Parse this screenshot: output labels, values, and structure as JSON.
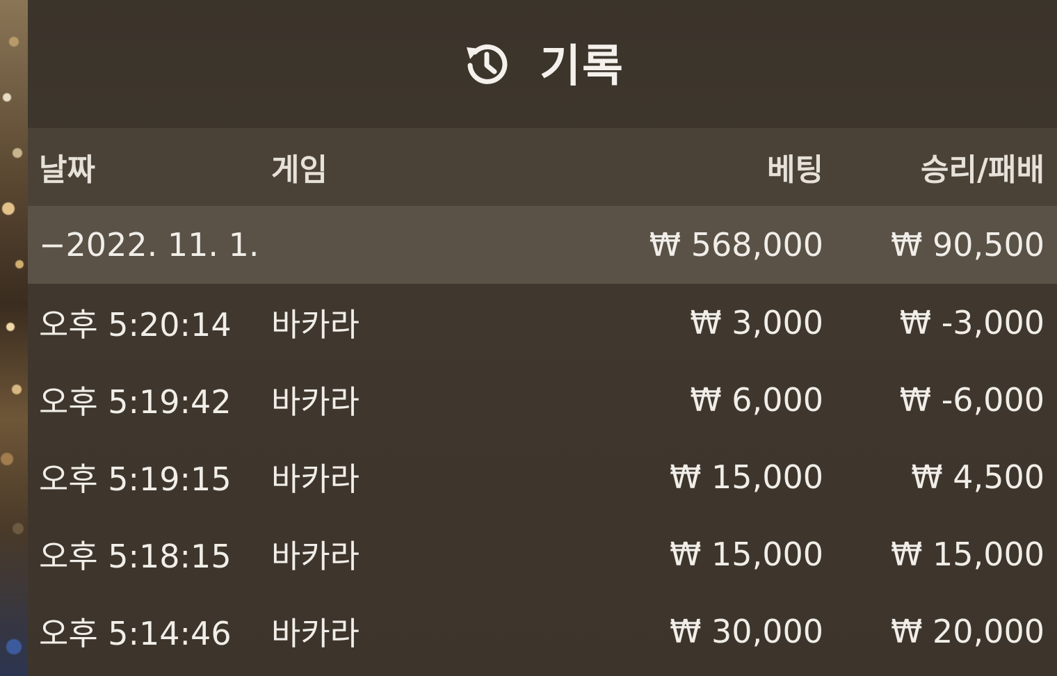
{
  "header": {
    "title": "기록",
    "icon": "history-icon"
  },
  "columns": {
    "date": "날짜",
    "game": "게임",
    "bet": "베팅",
    "win_loss": "승리/패배"
  },
  "summary": {
    "date": "−2022. 11. 1.",
    "bet": "₩ 568,000",
    "win_loss": "₩ 90,500"
  },
  "rows": [
    {
      "time": "오후 5:20:14",
      "game": "바카라",
      "bet": "₩ 3,000",
      "win_loss": "₩ -3,000"
    },
    {
      "time": "오후 5:19:42",
      "game": "바카라",
      "bet": "₩ 6,000",
      "win_loss": "₩ -6,000"
    },
    {
      "time": "오후 5:19:15",
      "game": "바카라",
      "bet": "₩ 15,000",
      "win_loss": "₩ 4,500"
    },
    {
      "time": "오후 5:18:15",
      "game": "바카라",
      "bet": "₩ 15,000",
      "win_loss": "₩ 15,000"
    },
    {
      "time": "오후 5:14:46",
      "game": "바카라",
      "bet": "₩ 30,000",
      "win_loss": "₩ 20,000"
    }
  ]
}
